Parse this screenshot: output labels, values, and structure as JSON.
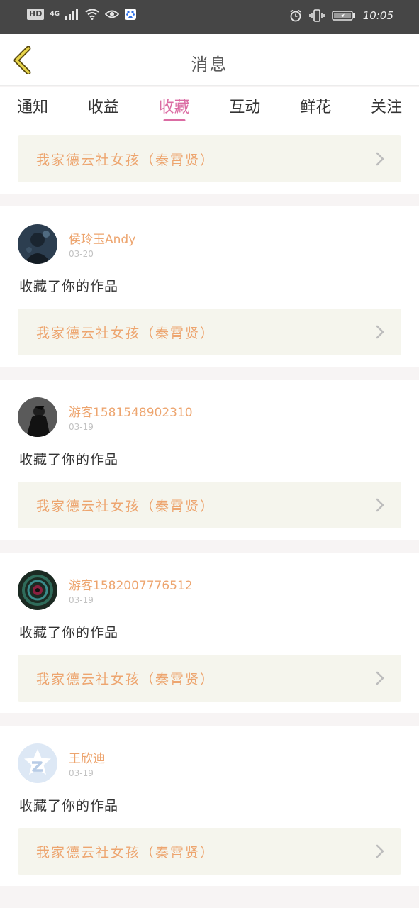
{
  "status_bar": {
    "hd": "HD",
    "network": "4G",
    "time": "10:05"
  },
  "header": {
    "title": "消息"
  },
  "tabs": [
    {
      "label": "通知",
      "active": false
    },
    {
      "label": "收益",
      "active": false
    },
    {
      "label": "收藏",
      "active": true
    },
    {
      "label": "互动",
      "active": false
    },
    {
      "label": "鲜花",
      "active": false
    },
    {
      "label": "关注",
      "active": false
    }
  ],
  "top_card": {
    "work_title": "我家德云社女孩（秦霄贤）"
  },
  "notifications": [
    {
      "user_name": "侯玲玉Andy",
      "date": "03-20",
      "action": "收藏了你的作品",
      "work_title": "我家德云社女孩（秦霄贤）"
    },
    {
      "user_name": "游客1581548902310",
      "date": "03-19",
      "action": "收藏了你的作品",
      "work_title": "我家德云社女孩（秦霄贤）"
    },
    {
      "user_name": "游客1582007776512",
      "date": "03-19",
      "action": "收藏了你的作品",
      "work_title": "我家德云社女孩（秦霄贤）"
    },
    {
      "user_name": "王欣迪",
      "date": "03-19",
      "action": "收藏了你的作品",
      "work_title": "我家德云社女孩（秦霄贤）"
    }
  ],
  "colors": {
    "accent_pink": "#db6ca3",
    "name_orange": "#eda56f",
    "card_bg": "#f5f5ed",
    "status_bar_bg": "#464646"
  }
}
